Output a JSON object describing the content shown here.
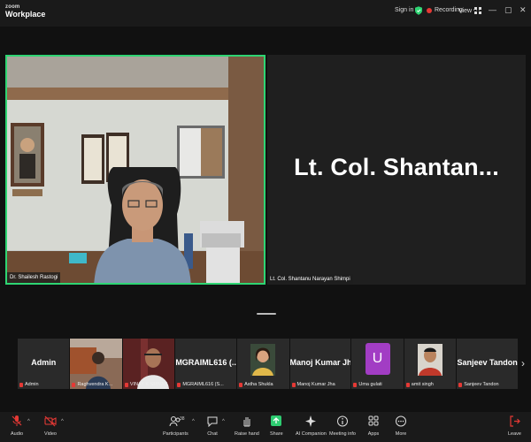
{
  "app": {
    "logo_top": "zoom",
    "logo_bottom": "Workplace"
  },
  "titlebar": {
    "signin": "Sign in",
    "recording": "Recording",
    "view": "View",
    "controls": [
      "⋯",
      "—",
      "▢",
      "✕"
    ]
  },
  "stage": {
    "speaker_a": {
      "name": "Dr. Shailesh Rastogi"
    },
    "speaker_b": {
      "display_name": "Lt. Col. Shantan...",
      "name": "Lt. Col. Shantanu Narayan Shimpi"
    }
  },
  "participants": [
    {
      "name": "Admin",
      "tag": "Admin",
      "type": "name"
    },
    {
      "name": "",
      "tag": "Raghvendra K...",
      "type": "video"
    },
    {
      "name": "",
      "tag": "VINAY K SRIVAS",
      "type": "video"
    },
    {
      "name": "MGRAIML616 (...",
      "tag": "MGRAIML616 (S...",
      "type": "name"
    },
    {
      "name": "",
      "tag": "Astha Shukla",
      "type": "photo"
    },
    {
      "name": "Manoj Kumar Jha",
      "tag": "Manoj Kumar Jha",
      "type": "name"
    },
    {
      "name": "U",
      "tag": "Uma gulati",
      "type": "letter"
    },
    {
      "name": "",
      "tag": "amit singh",
      "type": "photo"
    },
    {
      "name": "Sanjeev Tandon",
      "tag": "Sanjeev Tandon",
      "type": "name"
    }
  ],
  "strip_next": "›",
  "toolbar": {
    "audio": "Audio",
    "video": "Video",
    "participants": "Participants",
    "participants_count": "38",
    "chat": "Chat",
    "raise_hand": "Raise hand",
    "share": "Share",
    "ai": "AI Companion",
    "meeting_info": "Meeting info",
    "apps": "Apps",
    "more": "More",
    "leave": "Leave"
  },
  "colors": {
    "active_border": "#2ed573",
    "muted": "#e53935",
    "share": "#2ecc71",
    "letter_avatar": "#a23dc4"
  }
}
